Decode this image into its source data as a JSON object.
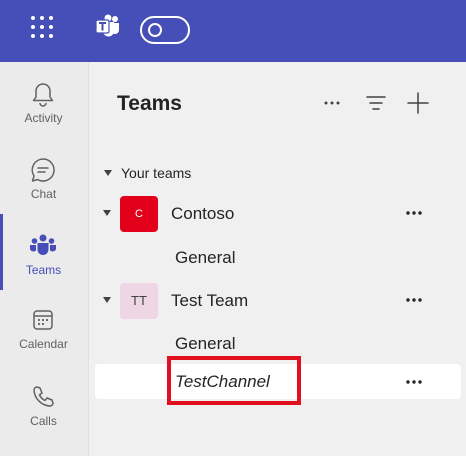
{
  "topbar": {
    "icons": [
      "app-launcher-icon",
      "teams-logo-icon",
      "toggle-switch"
    ]
  },
  "rail": {
    "items": [
      {
        "label": "Activity",
        "icon": "bell-icon"
      },
      {
        "label": "Chat",
        "icon": "chat-icon"
      },
      {
        "label": "Teams",
        "icon": "teams-icon",
        "active": true
      },
      {
        "label": "Calendar",
        "icon": "calendar-icon"
      },
      {
        "label": "Calls",
        "icon": "phone-icon"
      }
    ]
  },
  "panel": {
    "title": "Teams",
    "header_icons": [
      "more-icon",
      "filter-icon",
      "plus-icon"
    ],
    "section_label": "Your teams",
    "teams": [
      {
        "initials": "C",
        "name": "Contoso",
        "avatar_color": "#e3001b",
        "channels": [
          "General"
        ]
      },
      {
        "initials": "TT",
        "name": "Test Team",
        "avatar_color": "#efd6e4",
        "channels": [
          "General",
          "TestChannel"
        ]
      }
    ],
    "selected_channel": "TestChannel"
  },
  "colors": {
    "brand": "#464eb8",
    "highlight": "#e0101f"
  }
}
